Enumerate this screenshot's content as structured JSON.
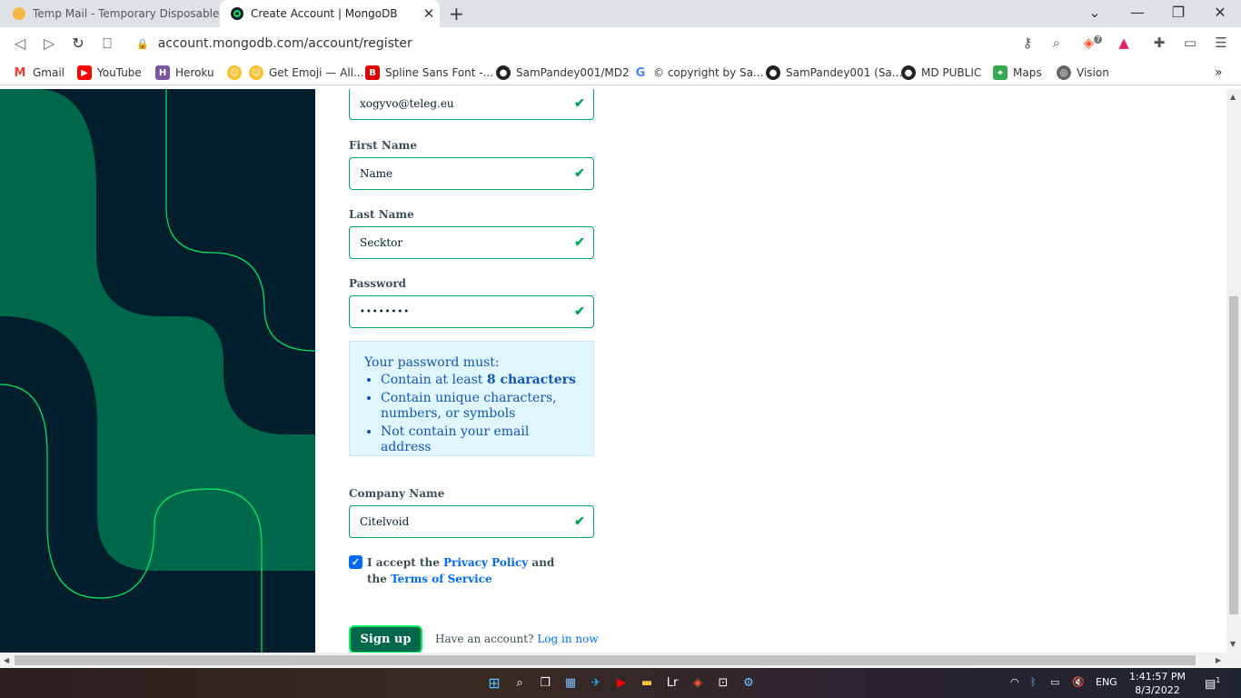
{
  "browser": {
    "tabs": [
      {
        "title": "Temp Mail - Temporary Disposable Em",
        "active": false
      },
      {
        "title": "Create Account | MongoDB",
        "active": true
      }
    ],
    "url": "account.mongodb.com/account/register",
    "bookmarks": [
      {
        "label": "Gmail",
        "icon": "gmail-icon"
      },
      {
        "label": "YouTube",
        "icon": "youtube-icon"
      },
      {
        "label": "Heroku",
        "icon": "heroku-icon"
      },
      {
        "label": "",
        "icon": "emoji-icon"
      },
      {
        "label": "Get Emoji — All...",
        "icon": "emoji-icon"
      },
      {
        "label": "Spline Sans Font -...",
        "icon": "font-icon"
      },
      {
        "label": "SamPandey001/MD2",
        "icon": "github-icon"
      },
      {
        "label": "© copyright by Sa...",
        "icon": "google-icon"
      },
      {
        "label": "SamPandey001 (Sa...",
        "icon": "github-icon"
      },
      {
        "label": "MD PUBLIC",
        "icon": "github-icon"
      },
      {
        "label": "Maps",
        "icon": "maps-icon"
      },
      {
        "label": "Vision",
        "icon": "globe-icon"
      }
    ],
    "brave_badge": "7"
  },
  "form": {
    "email_value": "xogyvo@teleg.eu",
    "first_name_label": "First Name",
    "first_name_value": "Name",
    "last_name_label": "Last Name",
    "last_name_value": "Secktor",
    "password_label": "Password",
    "password_value": "••••••••",
    "password_rules": {
      "heading": "Your password must:",
      "rule1_prefix": "Contain at least ",
      "rule1_bold": "8 characters",
      "rule2": "Contain unique characters, numbers, or symbols",
      "rule3": "Not contain your email address"
    },
    "company_label": "Company Name",
    "company_value": "Citelvoid",
    "accept": {
      "text1": "I accept the ",
      "privacy_link": "Privacy Policy",
      "text2": " and",
      "text3": "the ",
      "terms_link": "Terms of Service",
      "checked": true
    },
    "signup_label": "Sign up",
    "have_account": "Have an account? ",
    "login_link": "Log in now"
  },
  "taskbar": {
    "time": "1:41:57 PM",
    "date": "8/3/2022",
    "lang": "ENG",
    "notif_count": "1"
  },
  "colors": {
    "dark_bg": "#001e2b",
    "green": "#00684a",
    "bright_green": "#00ed64",
    "link_blue": "#016bf8"
  }
}
